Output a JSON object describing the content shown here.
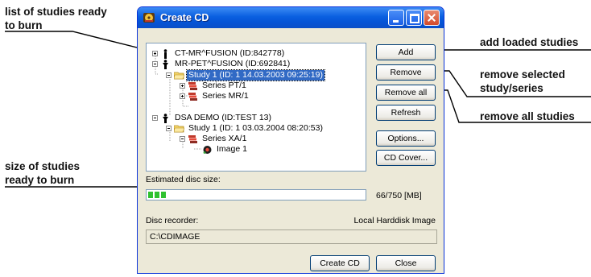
{
  "callouts": {
    "list_of_studies": [
      "list of studies ready",
      "to burn"
    ],
    "size_of_studies": [
      "size of studies",
      "ready to burn"
    ],
    "add_loaded": "add loaded studies",
    "remove_selected": [
      "remove selected",
      "study/series"
    ],
    "remove_all": "remove all studies"
  },
  "window": {
    "title": "Create CD"
  },
  "tree": [
    {
      "label": "CT-MR^FUSION (ID:842778)",
      "icon": "patient-icon",
      "expander": "plus"
    },
    {
      "label": "MR-PET^FUSION (ID:692841)",
      "icon": "patient-icon",
      "expander": "minus"
    },
    {
      "label": "Study 1 (ID: 1 14.03.2003 09:25:19)",
      "icon": "folder-open-icon",
      "expander": "minus",
      "selected": true
    },
    {
      "label": "Series PT/1",
      "icon": "series-stack-icon",
      "expander": "plus"
    },
    {
      "label": "Series MR/1",
      "icon": "series-stack-icon",
      "expander": "plus"
    },
    {
      "label": "DSA DEMO (ID:TEST 13)",
      "icon": "patient-icon",
      "expander": "minus"
    },
    {
      "label": "Study 1 (ID: 1 03.03.2004 08:20:53)",
      "icon": "folder-open-icon",
      "expander": "minus"
    },
    {
      "label": "Series XA/1",
      "icon": "series-stack-icon",
      "expander": "minus"
    },
    {
      "label": "Image 1",
      "icon": "image-icon",
      "expander": "none"
    }
  ],
  "buttons": {
    "add": "Add",
    "remove": "Remove",
    "remove_all": "Remove all",
    "refresh": "Refresh",
    "options": "Options...",
    "cd_cover": "CD Cover...",
    "create_cd": "Create CD",
    "close": "Close"
  },
  "disc_size": {
    "label": "Estimated disc size:",
    "value": "66/750 [MB]",
    "fraction": 0.088
  },
  "recorder": {
    "label": "Disc recorder:",
    "value": "Local Harddisk Image"
  },
  "path": "C:\\CDIMAGE",
  "colors": {
    "titlebar": "#0554d6",
    "selection": "#316ac5",
    "progress": "#2fc12f"
  }
}
